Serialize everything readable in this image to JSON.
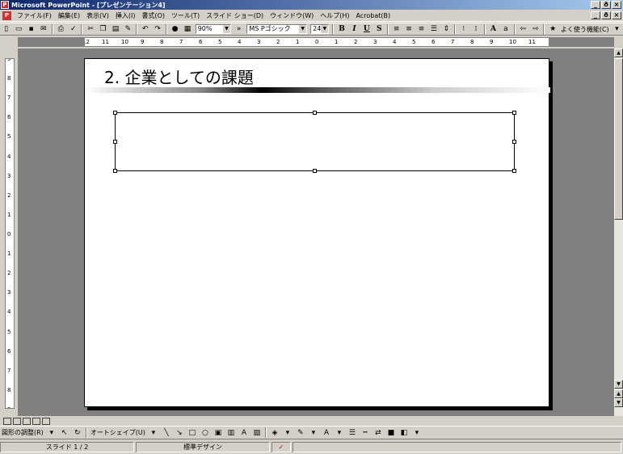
{
  "window": {
    "title": "Microsoft PowerPoint - [プレゼンテーション4]",
    "controls": [
      "_",
      "ð",
      "×"
    ]
  },
  "menu": {
    "items": [
      "ファイル(F)",
      "編集(E)",
      "表示(V)",
      "挿入(I)",
      "書式(O)",
      "ツール(T)",
      "スライド ショー(D)",
      "ウィンドウ(W)",
      "ヘルプ(H)",
      "Acrobat(B)"
    ]
  },
  "toolbar": {
    "zoom": "90%",
    "font_name": "MS Pゴシック",
    "font_size": "24",
    "bold": "B",
    "italic": "I",
    "underline": "U",
    "shadow": "S",
    "help_label": "よく使う機能(C)"
  },
  "ruler": {
    "horizontal": [
      "12",
      "11",
      "10",
      "9",
      "8",
      "7",
      "6",
      "5",
      "4",
      "3",
      "2",
      "1",
      "0",
      "1",
      "2",
      "3",
      "4",
      "5",
      "6",
      "7",
      "8",
      "9",
      "10",
      "11",
      "12"
    ],
    "vertical": [
      "9",
      "8",
      "7",
      "6",
      "5",
      "4",
      "3",
      "2",
      "1",
      "0",
      "1",
      "2",
      "3",
      "4",
      "5",
      "6",
      "7",
      "8",
      "9"
    ]
  },
  "slide": {
    "title": "2. 企業としての課題"
  },
  "drawing": {
    "draw_menu": "図形の調整(R)",
    "autoshape": "オートシェイプ(U)"
  },
  "status": {
    "slide_num": "スライド 1 / 2",
    "design": "標準デザイン"
  }
}
